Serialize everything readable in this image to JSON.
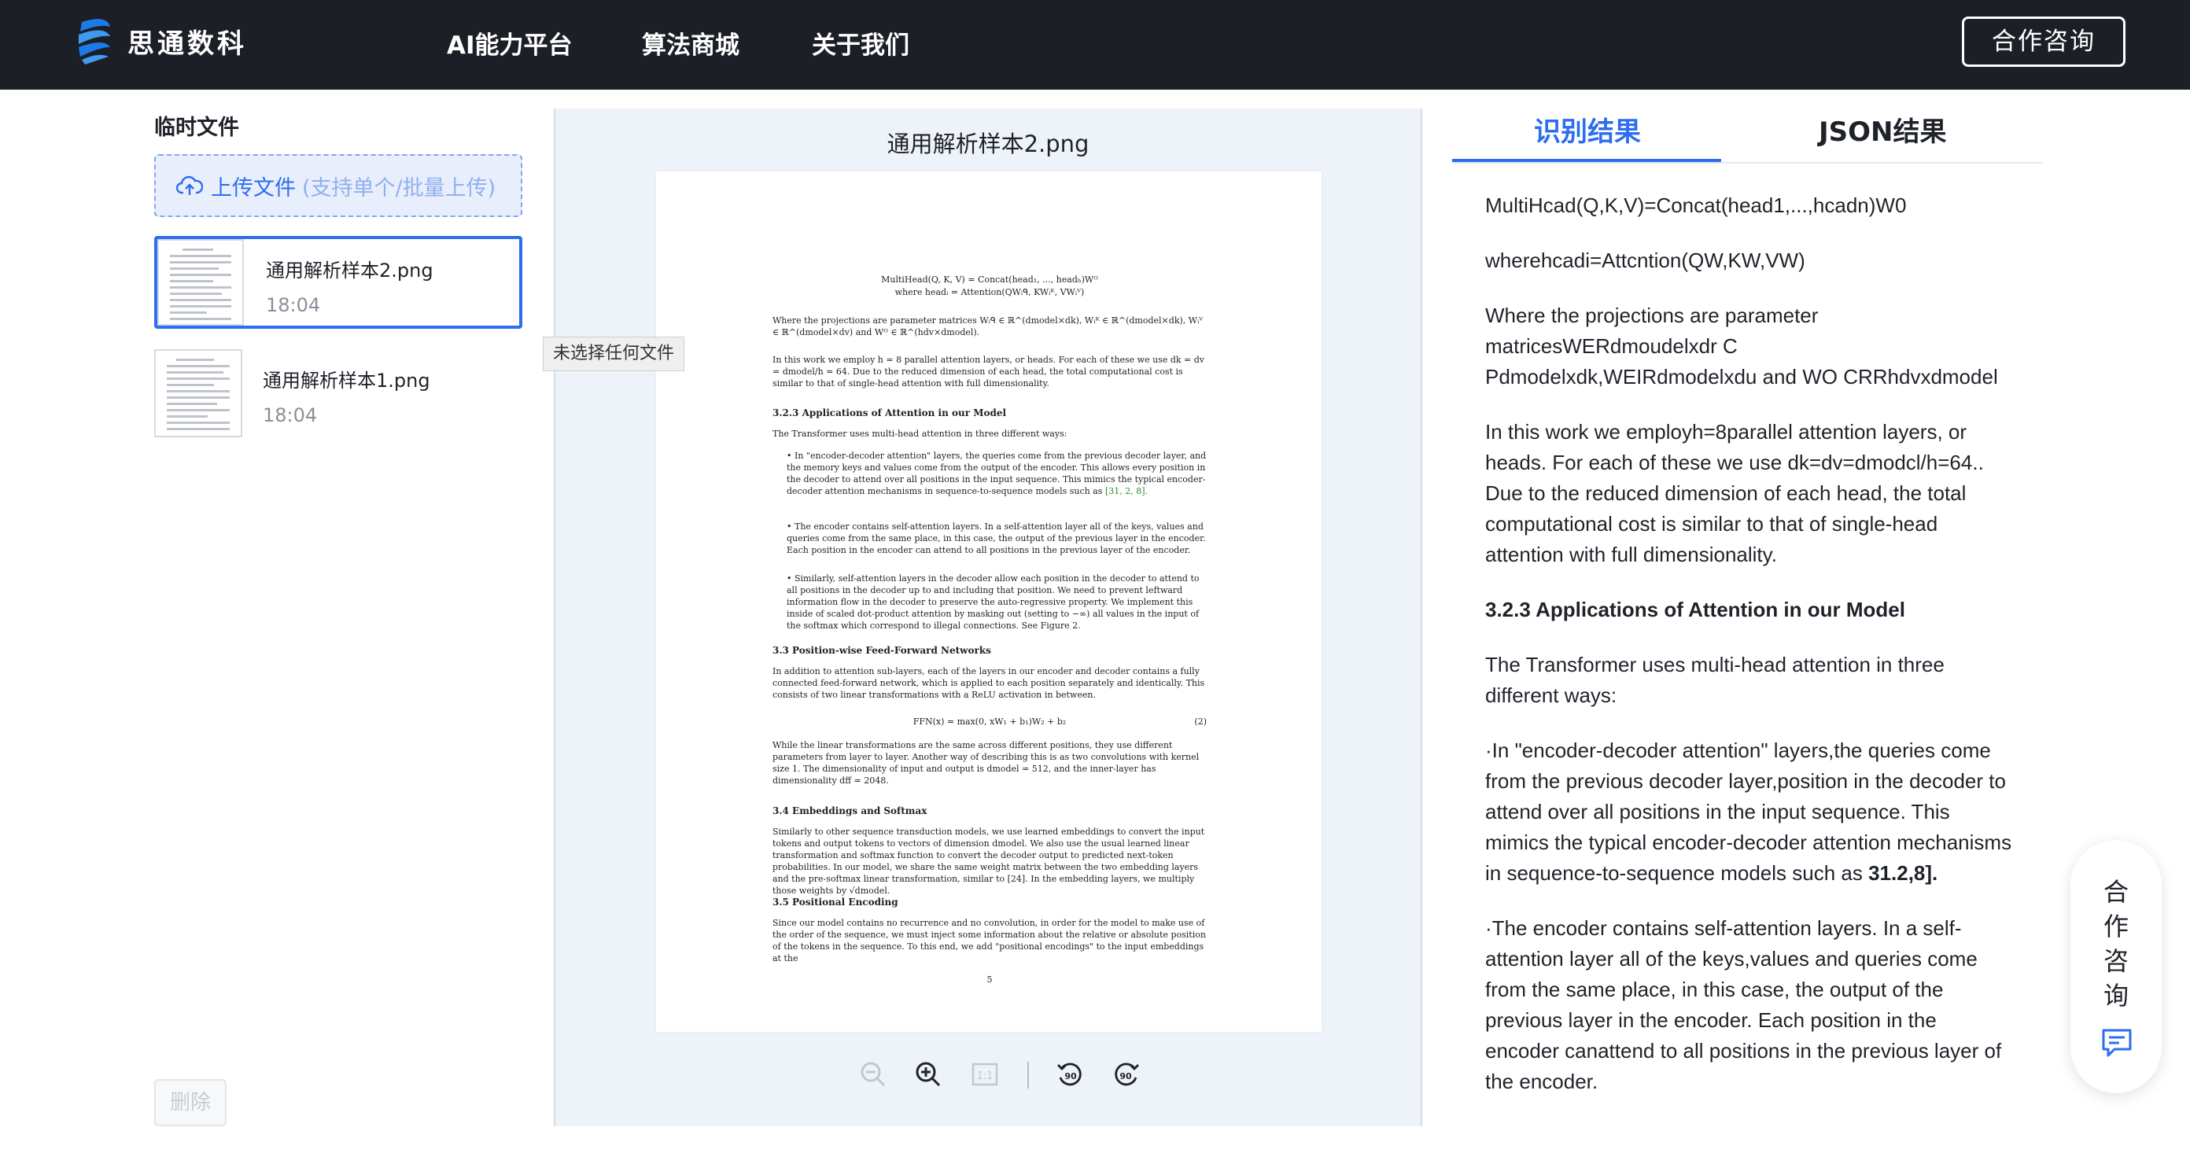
{
  "header": {
    "brand": "思通数科",
    "nav": [
      "AI能力平台",
      "算法商城",
      "关于我们"
    ],
    "contact_label": "合作咨询"
  },
  "sidebar": {
    "title": "临时文件",
    "upload_label": "上传文件",
    "upload_hint": "(支持单个/批量上传)",
    "files": [
      {
        "name": "通用解析样本2.png",
        "time": "18:04",
        "selected": true
      },
      {
        "name": "通用解析样本1.png",
        "time": "18:04",
        "selected": false
      }
    ],
    "tooltip": "未选择任何文件",
    "delete_label": "删除"
  },
  "preview": {
    "title": "通用解析样本2.png",
    "toolbar_icons": [
      "zoom-out-icon",
      "zoom-in-icon",
      "actual-size-icon",
      "rotate-left-icon",
      "rotate-right-icon"
    ],
    "paper": {
      "eq1a": "MultiHead(Q, K, V) = Concat(head₁, ..., headₕ)Wᴼ",
      "eq1b": "where headᵢ = Attention(QWᵢᑫ, KWᵢᴷ, VWᵢⱽ)",
      "p1": "Where the projections are parameter matrices Wᵢᑫ ∈ ℝ^(dmodel×dk), Wᵢᴷ ∈ ℝ^(dmodel×dk), Wᵢⱽ ∈ ℝ^(dmodel×dv) and Wᴼ ∈ ℝ^(hdv×dmodel).",
      "p2": "In this work we employ h = 8 parallel attention layers, or heads. For each of these we use dk = dv = dmodel/h = 64. Due to the reduced dimension of each head, the total computational cost is similar to that of single-head attention with full dimensionality.",
      "h1": "3.2.3   Applications of Attention in our Model",
      "p3": "The Transformer uses multi-head attention in three different ways:",
      "b1": "• In \"encoder-decoder attention\" layers, the queries come from the previous decoder layer, and the memory keys and values come from the output of the encoder. This allows every position in the decoder to attend over all positions in the input sequence. This mimics the typical encoder-decoder attention mechanisms in sequence-to-sequence models such as",
      "b1ref": "[31, 2, 8].",
      "b2": "• The encoder contains self-attention layers. In a self-attention layer all of the keys, values and queries come from the same place, in this case, the output of the previous layer in the encoder. Each position in the encoder can attend to all positions in the previous layer of the encoder.",
      "b3": "• Similarly, self-attention layers in the decoder allow each position in the decoder to attend to all positions in the decoder up to and including that position. We need to prevent leftward information flow in the decoder to preserve the auto-regressive property. We implement this inside of scaled dot-product attention by masking out (setting to −∞) all values in the input of the softmax which correspond to illegal connections. See Figure 2.",
      "h2": "3.3   Position-wise Feed-Forward Networks",
      "p4": "In addition to attention sub-layers, each of the layers in our encoder and decoder contains a fully connected feed-forward network, which is applied to each position separately and identically. This consists of two linear transformations with a ReLU activation in between.",
      "eq2": "FFN(x) = max(0, xW₁ + b₁)W₂ + b₂",
      "eq2n": "(2)",
      "p5": "While the linear transformations are the same across different positions, they use different parameters from layer to layer. Another way of describing this is as two convolutions with kernel size 1. The dimensionality of input and output is dmodel = 512, and the inner-layer has dimensionality dff = 2048.",
      "h3": "3.4   Embeddings and Softmax",
      "p6": "Similarly to other sequence transduction models, we use learned embeddings to convert the input tokens and output tokens to vectors of dimension dmodel. We also use the usual learned linear transformation and softmax function to convert the decoder output to predicted next-token probabilities. In our model, we share the same weight matrix between the two embedding layers and the pre-softmax linear transformation, similar to [24]. In the embedding layers, we multiply those weights by √dmodel.",
      "h4": "3.5   Positional Encoding",
      "p7": "Since our model contains no recurrence and no convolution, in order for the model to make use of the order of the sequence, we must inject some information about the relative or absolute position of the tokens in the sequence. To this end, we add \"positional encodings\" to the input embeddings at the",
      "pagenum": "5"
    }
  },
  "results": {
    "tab_recognition": "识别结果",
    "tab_json": "JSON结果",
    "paragraphs": [
      "MultiHcad(Q,K,V)=Concat(head1,...,hcadn)W0",
      "wherehcadi=Attcntion(QW,KW,VW)",
      "Where the projections are parameter matricesWERdmoudelxdr C Pdmodelxdk,WEIRdmodelxdu and WO CRRhdvxdmodel",
      "In this work we employh=8parallel attention layers, or heads. For each of these we use dk=dv=dmodcl/h=64.. Due to the reduced dimension of each head, the total computational cost is similar to that of single-head attention with full dimensionality.",
      "3.2.3 Applications of Attention in our Model",
      "The Transformer uses multi-head attention in three different ways:",
      "·In \"encoder-decoder attention\" layers,the queries come from the previous decoder layer,position in the decoder to attend over all positions in the input sequence. This mimics the typical encoder-decoder attention mechanisms in sequence-to-sequence models such as",
      "31.2,8].",
      "·The encoder contains self-attention layers. In a self-attention layer all of the keys,values and queries come from the same place, in this case, the output of the previous layer in the encoder. Each position in the encoder canattend to all positions in the previous layer of the encoder."
    ]
  },
  "float_consult": {
    "label": "合作咨询"
  }
}
